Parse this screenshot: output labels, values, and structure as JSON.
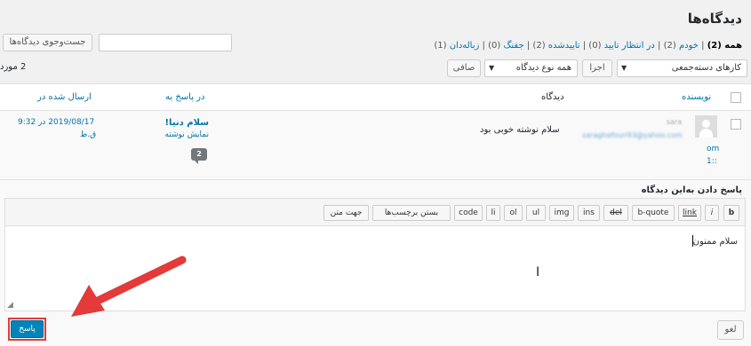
{
  "page": {
    "title": "دیدگاه‌ها"
  },
  "search": {
    "button_label": "جست‌وجوی دیدگاه‌ها",
    "placeholder": ""
  },
  "filters": {
    "all": "همه",
    "all_count": "(2)",
    "mine": "خودم",
    "mine_count": "(2)",
    "pending": "در انتظار تایید",
    "pending_count": "(0)",
    "approved": "تاییدشده",
    "approved_count": "(2)",
    "spam": "جفنگ",
    "spam_count": "(0)",
    "trash": "زباله‌دان",
    "trash_count": "(1)"
  },
  "toolbar": {
    "bulk_actions": "کارهای دسته‌جمعی",
    "apply": "اجرا",
    "comment_type": "همه نوع دیدگاه",
    "filter": "صافی",
    "count": "2 مورد"
  },
  "table": {
    "headers": {
      "author": "نویسنده",
      "comment": "دیدگاه",
      "in_response_to": "در پاسخ به",
      "submitted_on": "ارسال شده در"
    },
    "row": {
      "author_name": "sara",
      "author_email": "saraghafouri93@yahoo.com",
      "author_ip_1": "om",
      "author_ip_2": "1::",
      "comment": "سلام نوشته خوبی بود",
      "post_title": "سلام دنیا!",
      "view_post": "نمایش نوشته",
      "comment_count": "2",
      "date": "2019/08/17 در 9:32",
      "date_suffix": "ق.ظ"
    }
  },
  "reply": {
    "title": "پاسخ دادن به‌این دیدگاه",
    "quicktags": [
      "b",
      "i",
      "link",
      "b-quote",
      "del",
      "ins",
      "img",
      "ul",
      "ol",
      "li",
      "code",
      "بستن برچسب‌ها",
      "جهت متن"
    ],
    "text": "سلام ممنون",
    "cancel": "لغو",
    "submit": "پاسخ"
  },
  "colors": {
    "accent": "#0073aa",
    "primary_button": "#0085ba",
    "highlight": "#e33a3a"
  }
}
